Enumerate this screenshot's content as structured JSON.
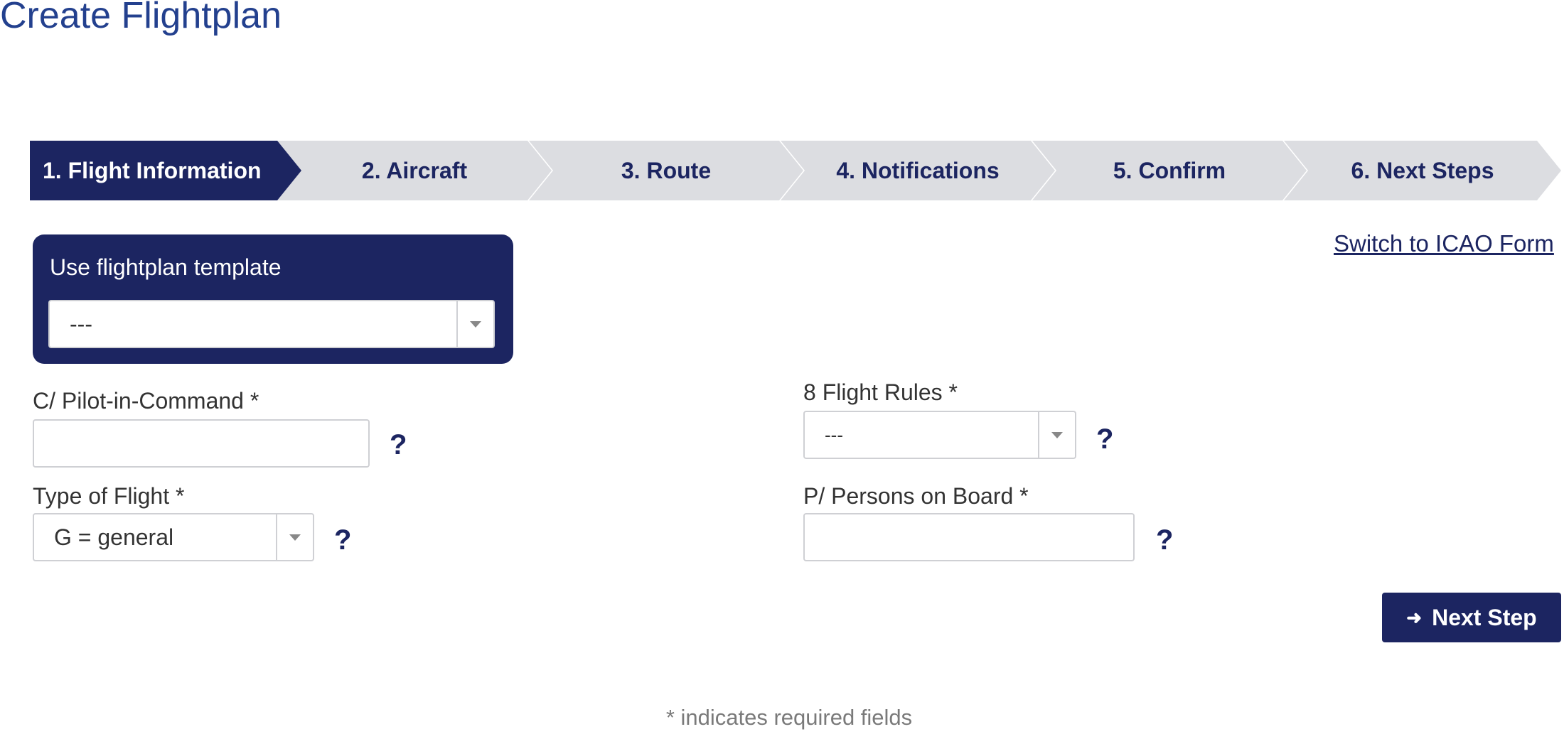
{
  "page": {
    "title": "Create Flightplan"
  },
  "wizard": {
    "steps": [
      {
        "label": "1. Flight Information",
        "active": true
      },
      {
        "label": "2. Aircraft",
        "active": false
      },
      {
        "label": "3. Route",
        "active": false
      },
      {
        "label": "4. Notifications",
        "active": false
      },
      {
        "label": "5. Confirm",
        "active": false
      },
      {
        "label": "6. Next Steps",
        "active": false
      }
    ]
  },
  "switch_link": "Switch to ICAO Form",
  "template": {
    "label": "Use flightplan template",
    "value": "---"
  },
  "form": {
    "pilot": {
      "label": "C/ Pilot-in-Command *",
      "value": ""
    },
    "flight_rules": {
      "label": "8 Flight Rules *",
      "value": "---"
    },
    "type_of_flight": {
      "label": "Type of Flight *",
      "value": "G = general"
    },
    "persons_on_board": {
      "label": "P/ Persons on Board *",
      "value": ""
    },
    "help_glyph": "?"
  },
  "next_button": {
    "label": "Next Step",
    "icon": "arrow-right-icon"
  },
  "required_note": "* indicates required fields",
  "colors": {
    "navy": "#1c2561",
    "title_blue": "#23408e",
    "step_gray": "#dcdde1"
  }
}
